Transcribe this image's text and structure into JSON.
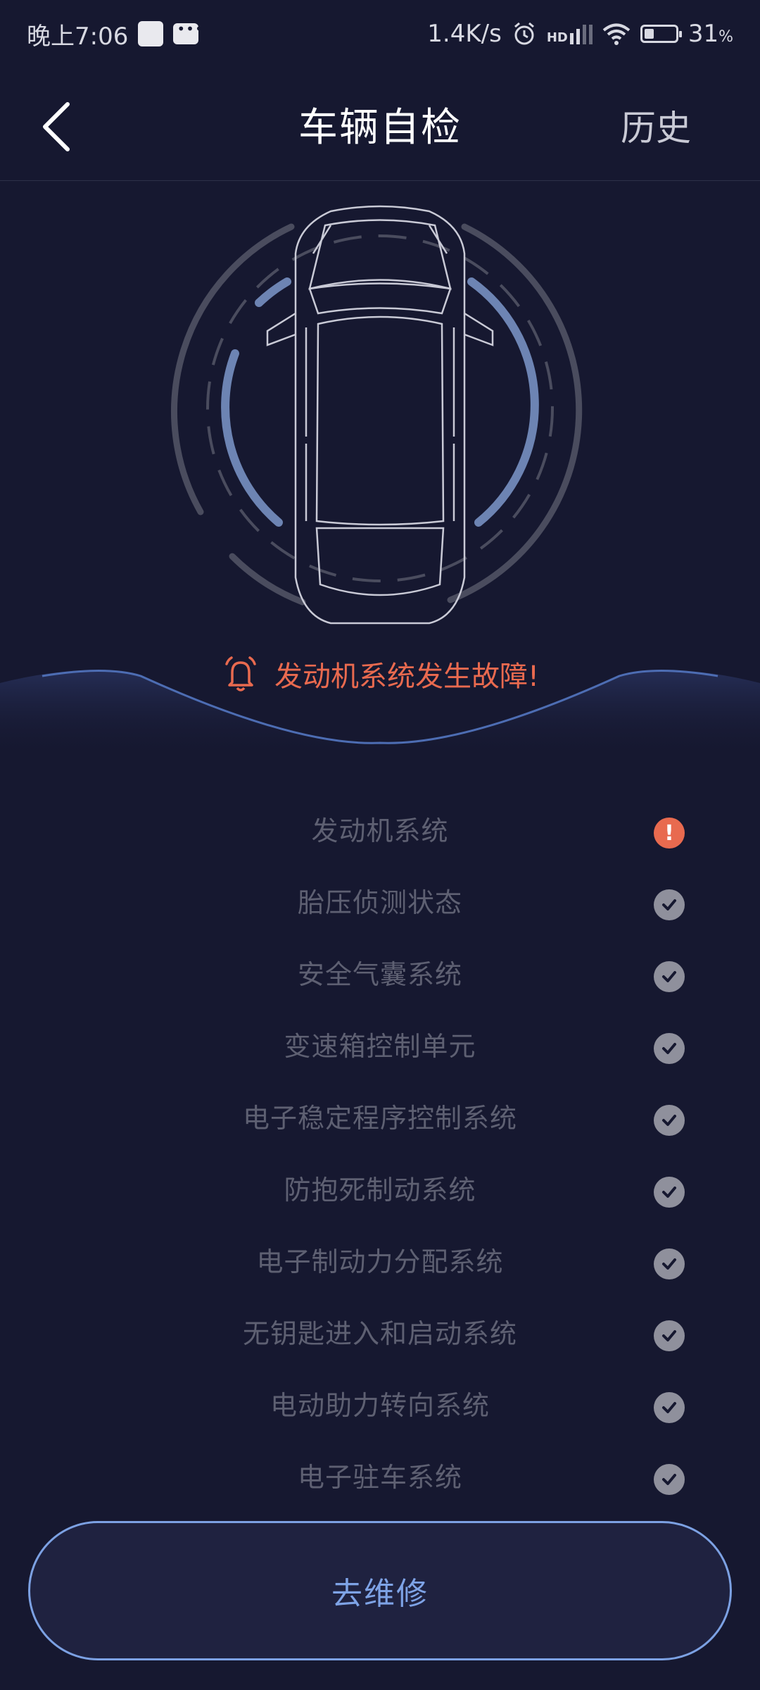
{
  "status_bar": {
    "time": "晚上7:06",
    "net_speed": "1.4K/s",
    "hd": "HD",
    "battery_percent": "31",
    "battery_unit": "%",
    "battery_level": 0.31
  },
  "header": {
    "title": "车辆自检",
    "history_label": "历史"
  },
  "alert": {
    "text": "发动机系统发生故障!",
    "color": "#e96a4f"
  },
  "check_items": [
    {
      "label": "发动机系统",
      "status": "error"
    },
    {
      "label": "胎压侦测状态",
      "status": "ok"
    },
    {
      "label": "安全气囊系统",
      "status": "ok"
    },
    {
      "label": "变速箱控制单元",
      "status": "ok"
    },
    {
      "label": "电子稳定程序控制系统",
      "status": "ok"
    },
    {
      "label": "防抱死制动系统",
      "status": "ok"
    },
    {
      "label": "电子制动力分配系统",
      "status": "ok"
    },
    {
      "label": "无钥匙进入和启动系统",
      "status": "ok"
    },
    {
      "label": "电动助力转向系统",
      "status": "ok"
    },
    {
      "label": "电子驻车系统",
      "status": "ok"
    }
  ],
  "repair_button": {
    "label": "去维修",
    "accent": "#7ca1e3"
  },
  "colors": {
    "background": "#161830",
    "error": "#e86a4f",
    "ok": "#8f909c"
  }
}
